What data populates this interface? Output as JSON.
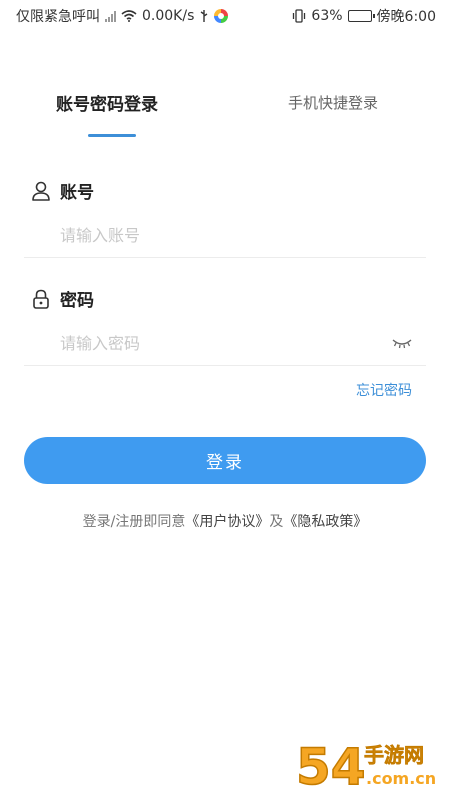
{
  "status_bar": {
    "left_text": "仅限紧急呼叫",
    "speed": "0.00K/s",
    "battery_pct": "63%",
    "battery_level": 0.63,
    "time": "傍晚6:00"
  },
  "tabs": [
    {
      "label": "账号密码登录",
      "active": true
    },
    {
      "label": "手机快捷登录",
      "active": false
    }
  ],
  "account": {
    "label": "账号",
    "placeholder": "请输入账号",
    "value": ""
  },
  "password": {
    "label": "密码",
    "placeholder": "请输入密码",
    "value": ""
  },
  "forgot_label": "忘记密码",
  "login_label": "登录",
  "agreement": {
    "prefix": "登录/注册即同意",
    "user_agreement": "《用户协议》",
    "conjunction": "及",
    "privacy_policy": "《隐私政策》"
  },
  "watermark": {
    "brand": "54",
    "mark": "手游网",
    "domain": ".com.cn"
  },
  "colors": {
    "accent": "#3d8fd8",
    "button": "#3f9bf0"
  },
  "icons": [
    "signal-icon",
    "wifi-icon",
    "usb-icon",
    "app-icon",
    "vibrate-icon",
    "battery-icon",
    "user-icon",
    "lock-icon",
    "eye-closed-icon"
  ]
}
